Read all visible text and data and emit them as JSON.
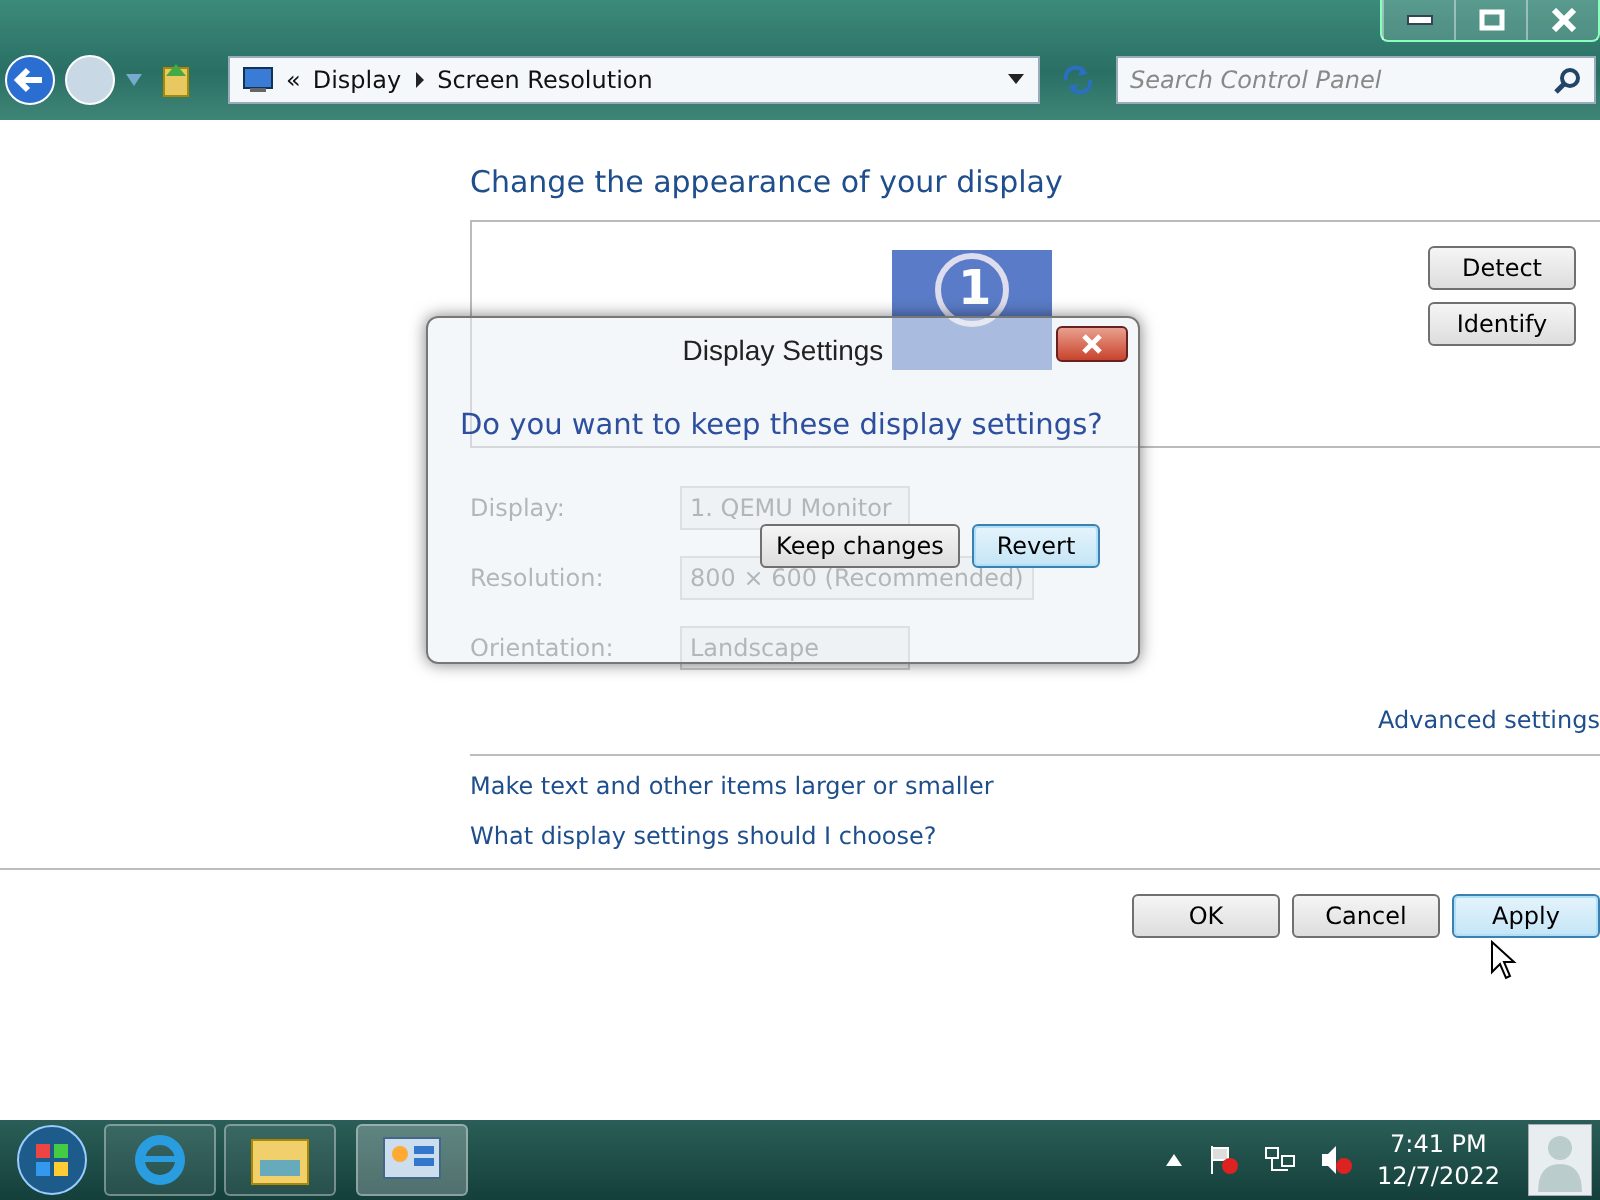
{
  "address_bar": {
    "chevron": "«",
    "breadcrumb": [
      "Display",
      "Screen Resolution"
    ]
  },
  "search": {
    "placeholder": "Search Control Panel"
  },
  "heading": "Change the appearance of your display",
  "monitor": {
    "number": "1"
  },
  "monitor_buttons": [
    "Detect",
    "Identify"
  ],
  "settings": [
    {
      "label": "Display:",
      "value": "1. QEMU Monitor"
    },
    {
      "label": "Resolution:",
      "value": "800 × 600 (Recommended)"
    },
    {
      "label": "Orientation:",
      "value": "Landscape"
    }
  ],
  "advanced_link": "Advanced settings",
  "links": [
    "Make text and other items larger or smaller",
    "What display settings should I choose?"
  ],
  "footer_buttons": [
    {
      "label": "OK",
      "focused": false
    },
    {
      "label": "Cancel",
      "focused": false
    },
    {
      "label": "Apply",
      "focused": true
    }
  ],
  "dialog": {
    "title": "Display Settings",
    "question": "Do you want to keep these display settings?",
    "buttons": [
      {
        "label": "Keep changes",
        "focused": false
      },
      {
        "label": "Revert",
        "focused": true
      }
    ]
  },
  "taskbar": {
    "time": "7:41 PM",
    "date": "12/7/2022"
  }
}
